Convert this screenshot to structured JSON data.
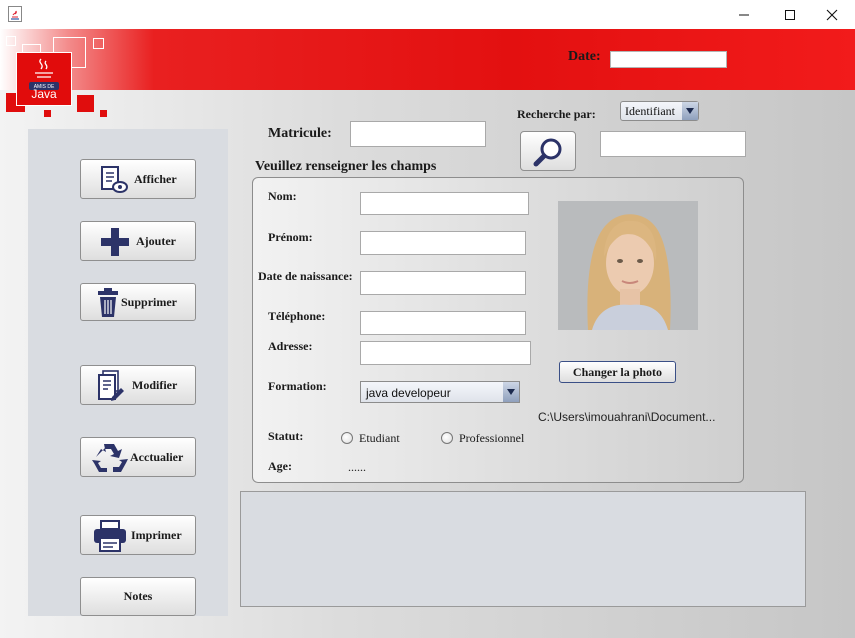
{
  "window": {
    "minimize_icon": "minimize-icon",
    "maximize_icon": "maximize-icon",
    "close_icon": "close-icon"
  },
  "header": {
    "logo_text": "Java",
    "date_label": "Date:",
    "date_value": ""
  },
  "search": {
    "label": "Recherche par:",
    "selected_option": "Identifiant",
    "value": ""
  },
  "form": {
    "matricule_label": "Matricule:",
    "matricule_value": "",
    "section_title": "Veuillez renseigner les champs",
    "nom_label": "Nom:",
    "prenom_label": "Prénom:",
    "naissance_label": "Date de naissance:",
    "telephone_label": "Téléphone:",
    "adresse_label": "Adresse:",
    "formation_label": "Formation:",
    "formation_selected": "java developeur",
    "statut_label": "Statut:",
    "statut_options": [
      "Etudiant",
      "Professionnel"
    ],
    "age_label": "Age:",
    "age_value": "......",
    "change_photo_label": "Changer la photo",
    "photo_path": "C:\\Users\\imouahrani\\Document..."
  },
  "sidebar": {
    "buttons": [
      {
        "label": "Afficher",
        "icon": "document-view-icon"
      },
      {
        "label": "Ajouter",
        "icon": "plus-icon"
      },
      {
        "label": "Supprimer",
        "icon": "trash-icon"
      },
      {
        "label": "Modifier",
        "icon": "document-edit-icon"
      },
      {
        "label": "Acctualier",
        "icon": "refresh-icon"
      },
      {
        "label": "Imprimer",
        "icon": "printer-icon"
      },
      {
        "label": "Notes",
        "icon": ""
      }
    ]
  },
  "colors": {
    "header_red": "#e31010",
    "sidebar_bg": "#d9dce1",
    "accent_navy": "#2c3368"
  }
}
